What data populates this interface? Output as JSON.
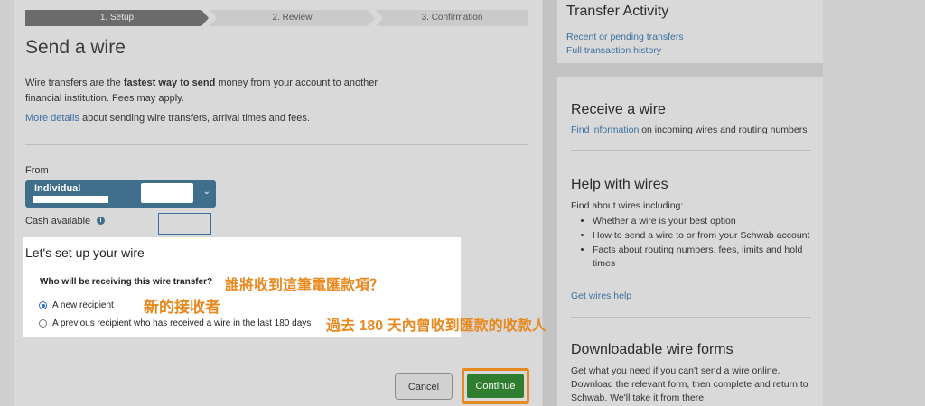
{
  "stepper": {
    "steps": [
      "1. Setup",
      "2. Review",
      "3. Confirmation"
    ]
  },
  "main": {
    "title": "Send a wire",
    "intro_before": "Wire transfers are the ",
    "intro_bold": "fastest way to send",
    "intro_after": " money from your account to another financial institution. Fees may apply.",
    "more_link": "More details",
    "more_text": " about sending wire transfers, arrival times and fees.",
    "from_label": "From",
    "account_name": "Individual",
    "cash_label": "Cash available"
  },
  "modal": {
    "title": "Let's set up your wire",
    "question": "Who will be receiving this wire transfer?",
    "question_cn": "誰將收到這筆電匯款項？",
    "options": [
      {
        "label": "A new recipient",
        "label_cn": "新的接收者",
        "selected": true
      },
      {
        "label": "A previous recipient who has received a wire in the last 180 days",
        "label_cn": "過去 180 天內曾收到匯款的收款人",
        "selected": false
      }
    ]
  },
  "buttons": {
    "cancel": "Cancel",
    "continue": "Continue"
  },
  "sidebar": {
    "transfer_activity": {
      "title": "Transfer Activity",
      "links": [
        "Recent or pending transfers",
        "Full transaction history"
      ]
    },
    "receive": {
      "title": "Receive a wire",
      "link": "Find information",
      "text": " on incoming wires and routing numbers"
    },
    "help": {
      "title": "Help with wires",
      "intro": "Find about wires including:",
      "items": [
        "Whether a wire is your best option",
        "How to send a wire to or from your Schwab account",
        "Facts about routing numbers, fees, limits and hold times"
      ],
      "link": "Get wires help"
    },
    "forms": {
      "title": "Downloadable wire forms",
      "text": "Get what you need if you can't send a wire online. Download the relevant form, then complete and return to Schwab. We'll take it from there."
    }
  },
  "colors": {
    "accent": "#3f6f8b",
    "link": "#3a6fa0",
    "primary_button": "#2f7d2e",
    "highlight": "#e8891f"
  }
}
